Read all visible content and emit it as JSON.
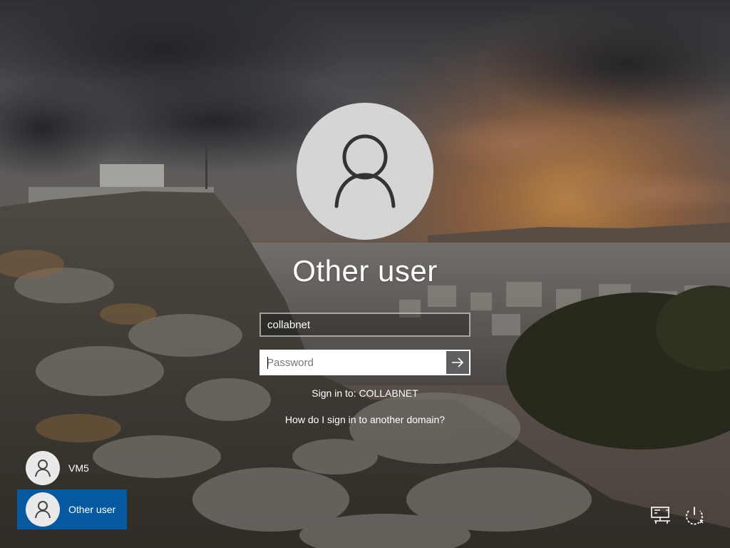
{
  "screen": {
    "user_display_name": "Other user"
  },
  "signin": {
    "username_value": "collabnet",
    "password_placeholder": "Password",
    "sign_in_to": "Sign in to: COLLABNET",
    "other_domain_link": "How do I sign in to another domain?"
  },
  "user_list": [
    {
      "label": "VM5"
    },
    {
      "label": "Other user"
    }
  ],
  "icons": {
    "avatar": "user-icon",
    "submit": "arrow-right-icon",
    "network": "network-icon",
    "power": "power-icon"
  },
  "colors": {
    "selected_tile": "#005daa",
    "avatar_bg": "#d5d5d5",
    "submit_bg": "#5f5f5f"
  }
}
